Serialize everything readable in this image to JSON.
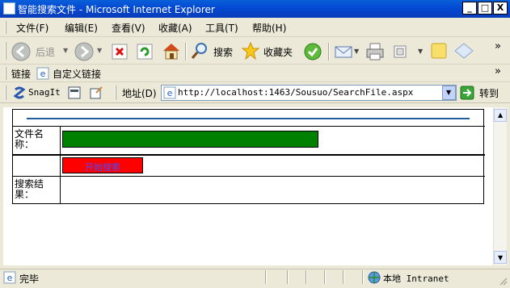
{
  "window": {
    "title": "智能搜索文件 - Microsoft Internet Explorer",
    "minimize": "_",
    "maximize": "□",
    "close": "X"
  },
  "menu": [
    "文件(F)",
    "编辑(E)",
    "查看(V)",
    "收藏(A)",
    "工具(T)",
    "帮助(H)"
  ],
  "toolbar": {
    "back_label": "后退",
    "search_label": "搜索",
    "favorites_label": "收藏夹",
    "chevron": "»"
  },
  "links": {
    "links_label": "链接",
    "custom_links": "自定义链接",
    "snagit": "SnagIt",
    "chevron": "»"
  },
  "address": {
    "label": "地址(D)",
    "url": "http://localhost:1463/Sousuo/SearchFile.aspx",
    "go_label": "转到"
  },
  "form": {
    "filename_label": "文件名称：",
    "search_button": "开始搜索",
    "result_label": "搜索结果："
  },
  "status": {
    "text": "完毕",
    "zone": "本地 Intranet"
  },
  "colors": {
    "titlebar": "#0A5FD8",
    "filename_input": "#008000",
    "search_button": "#FF0000",
    "rule_line": "#1F5F9F"
  }
}
